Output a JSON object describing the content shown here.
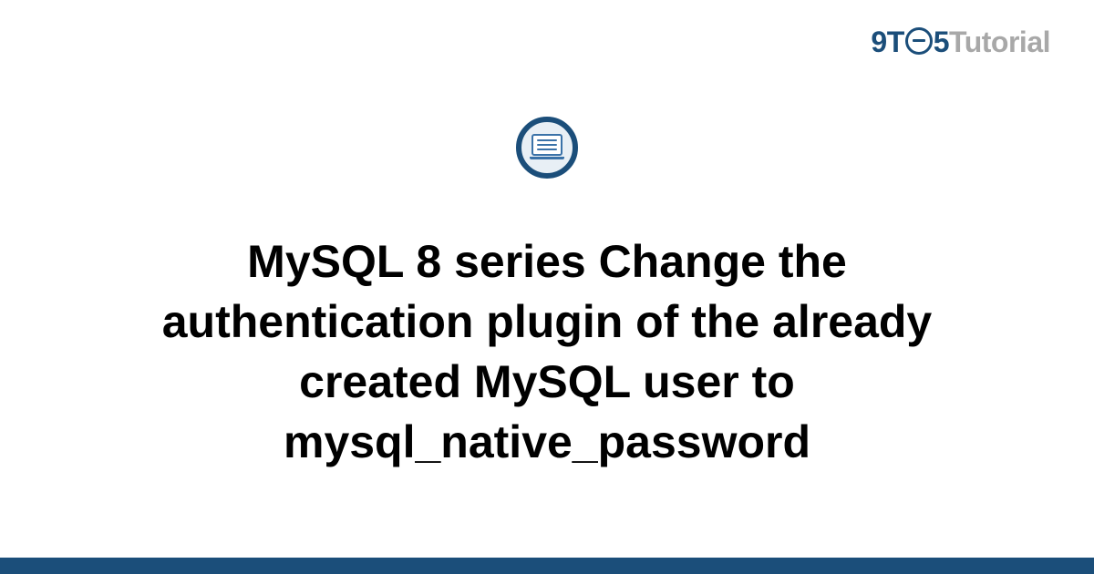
{
  "logo": {
    "part1": "9T",
    "part2": "5",
    "part3": "Tutorial"
  },
  "icon_name": "laptop-icon",
  "title": "MySQL 8 series Change the authentication plugin of the already created MySQL user to mysql_native_password",
  "colors": {
    "primary": "#1b4e7a",
    "muted": "#a8a8a8"
  }
}
